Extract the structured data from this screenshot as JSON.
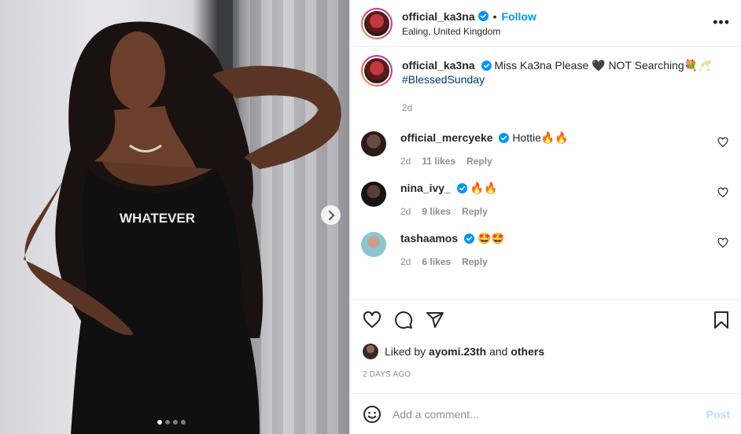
{
  "media": {
    "shirt_text": "WHATEVER",
    "carousel_count": 4,
    "carousel_active": 1,
    "next_icon": "chevron-right-icon"
  },
  "header": {
    "username": "official_ka3na",
    "separator": "•",
    "follow_label": "Follow",
    "location": "Ealing, United Kingdom",
    "more_icon": "more-horizontal-icon",
    "more_label": "•••"
  },
  "caption": {
    "username": "official_ka3na",
    "text": "Miss Ka3na Please 🖤 NOT Searching💐🥂",
    "hashtag": "#BlessedSunday",
    "time": "2d"
  },
  "comments": [
    {
      "username": "official_mercyeke",
      "text": "Hottie🔥🔥",
      "time": "2d",
      "likes": "11 likes",
      "reply": "Reply",
      "avatar_color": "#3a2a28"
    },
    {
      "username": "nina_ivy_",
      "text": "🔥🔥",
      "time": "2d",
      "likes": "9 likes",
      "reply": "Reply",
      "avatar_color": "#1b1b1b"
    },
    {
      "username": "tashaamos",
      "text": "🤩🤩",
      "time": "2d",
      "likes": "6 likes",
      "reply": "Reply",
      "avatar_color": "#9bcfd8"
    }
  ],
  "actions": {
    "like_icon": "heart-icon",
    "comment_icon": "comment-icon",
    "share_icon": "share-icon",
    "save_icon": "bookmark-icon"
  },
  "likes": {
    "prefix": "Liked by",
    "user": "ayomi.23th",
    "and": "and",
    "others": "others"
  },
  "time_ago": "2 DAYS AGO",
  "add_comment": {
    "placeholder": "Add a comment...",
    "post_label": "Post",
    "emoji_icon": "emoji-icon"
  },
  "colors": {
    "accent": "#0095f6",
    "verified": "#0095f6",
    "post_disabled": "#b2dffc"
  }
}
